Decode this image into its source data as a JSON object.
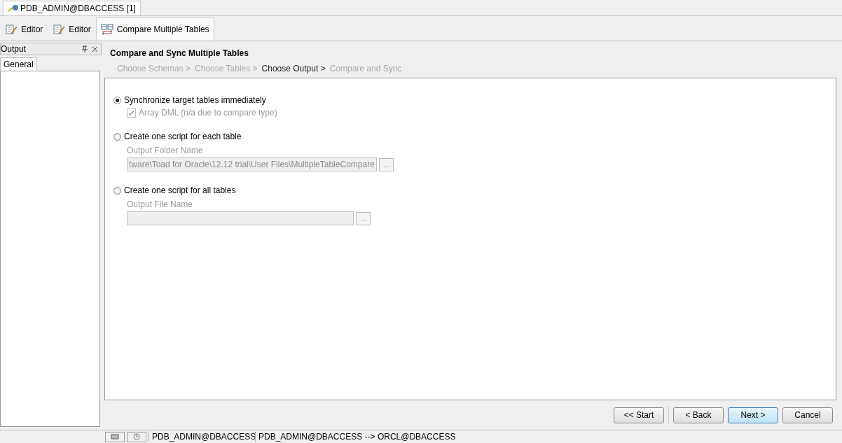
{
  "connection_tab": {
    "label": "PDB_ADMIN@DBACCESS [1]"
  },
  "editor_tabs": [
    {
      "label": "Editor",
      "kind": "editor",
      "selected": false
    },
    {
      "label": "Editor",
      "kind": "editor",
      "selected": false
    },
    {
      "label": "Compare Multiple Tables",
      "kind": "compare",
      "selected": true
    }
  ],
  "output_panel": {
    "title": "Output",
    "tabs": [
      {
        "label": "General",
        "selected": true
      }
    ]
  },
  "wizard": {
    "title": "Compare and Sync Multiple Tables",
    "steps": [
      {
        "label": "Choose Schemas >",
        "current": false
      },
      {
        "label": "Choose Tables >",
        "current": false
      },
      {
        "label": "Choose Output >",
        "current": true
      },
      {
        "label": "Compare and Sync",
        "current": false
      }
    ],
    "options": [
      {
        "label": "Synchronize target tables immediately",
        "selected": true,
        "kind": "checkbox",
        "checkbox": {
          "label": "Array DML (n/a due to compare type)",
          "checked": true
        }
      },
      {
        "label": "Create one script for each table",
        "selected": false,
        "kind": "path",
        "field": {
          "label": "Output Folder Name",
          "value": "tware\\Toad for Oracle\\12.12 trial\\User Files\\MultipleTableCompare",
          "browse": "..."
        }
      },
      {
        "label": "Create one script for all tables",
        "selected": false,
        "kind": "path",
        "field": {
          "label": "Output File Name",
          "browse": "..."
        }
      }
    ],
    "buttons": [
      {
        "label": "<< Start",
        "highlighted": false
      },
      {
        "label": "< Back",
        "highlighted": false
      },
      {
        "label": "Next >",
        "highlighted": true
      },
      {
        "label": "Cancel",
        "highlighted": false
      }
    ]
  },
  "status_bar": {
    "connection": "PDB_ADMIN@DBACCESS",
    "compare": "PDB_ADMIN@DBACCESS --> ORCL@DBACCESS"
  }
}
